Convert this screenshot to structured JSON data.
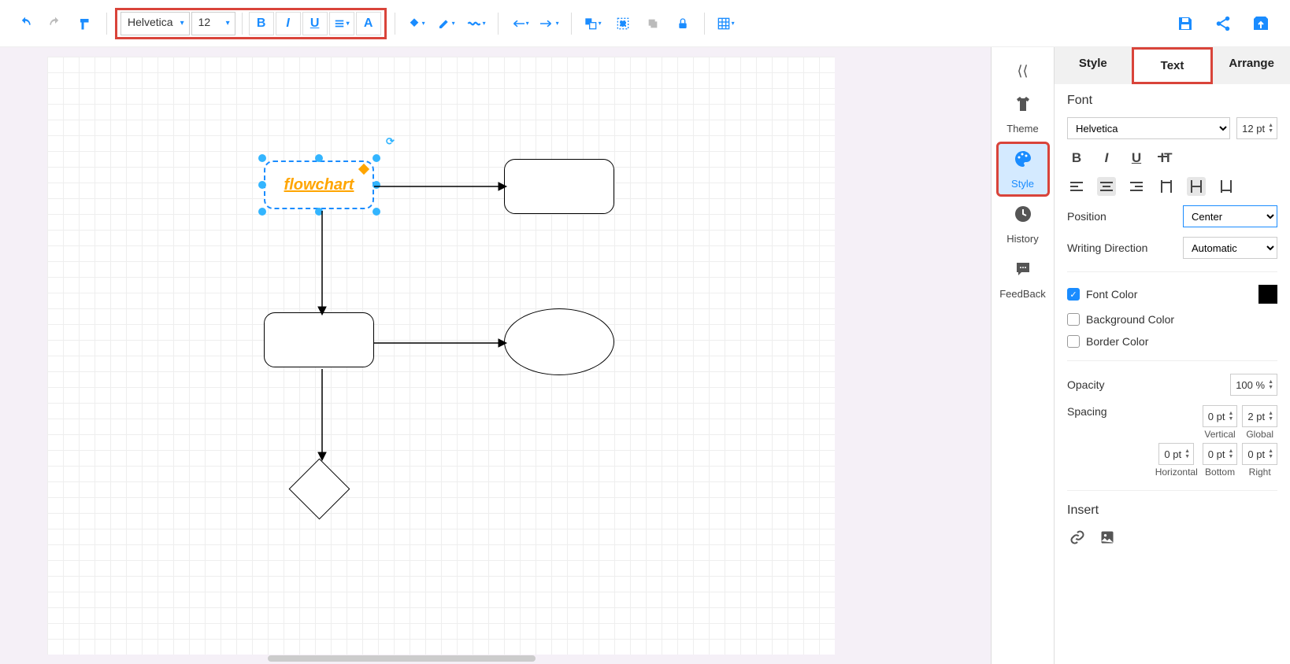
{
  "toolbar": {
    "font": "Helvetica",
    "size": "12"
  },
  "sidenav": {
    "theme": "Theme",
    "style": "Style",
    "history": "History",
    "feedback": "FeedBack"
  },
  "tabs": {
    "style": "Style",
    "text": "Text",
    "arrange": "Arrange"
  },
  "panel": {
    "font_title": "Font",
    "font_family": "Helvetica",
    "font_size": "12 pt",
    "position_label": "Position",
    "position_value": "Center",
    "writing_label": "Writing Direction",
    "writing_value": "Automatic",
    "font_color": "Font Color",
    "bg_color": "Background Color",
    "border_color": "Border Color",
    "opacity_label": "Opacity",
    "opacity_value": "100 %",
    "spacing_label": "Spacing",
    "spacing": {
      "vertical_val": "0 pt",
      "vertical": "Vertical",
      "global_val": "2 pt",
      "global": "Global",
      "horizontal_val": "0 pt",
      "horizontal": "Horizontal",
      "bottom_val": "0 pt",
      "bottom": "Bottom",
      "right_val": "0 pt",
      "right": "Right"
    },
    "insert_label": "Insert"
  },
  "canvas": {
    "node_text": "flowchart"
  }
}
